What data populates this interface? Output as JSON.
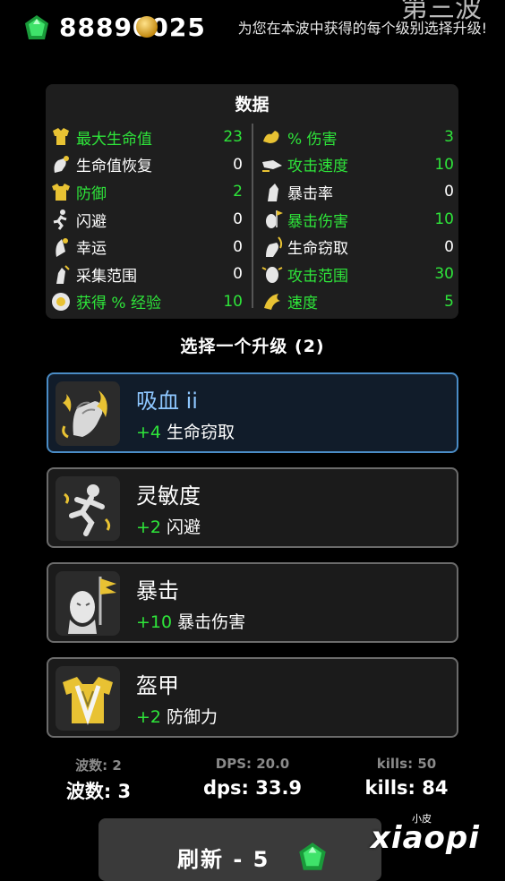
{
  "header": {
    "gem_count": "88890025",
    "wave_title": "第三波",
    "hint": "为您在本波中获得的每个级别选择升级!"
  },
  "stats": {
    "title": "数据",
    "left": [
      {
        "label": "最大生命值",
        "value": "23",
        "highlight": true,
        "icon": "heart-torso-icon"
      },
      {
        "label": "生命值恢复",
        "value": "0",
        "highlight": false,
        "icon": "regen-hand-icon"
      },
      {
        "label": "防御",
        "value": "2",
        "highlight": true,
        "icon": "armor-icon"
      },
      {
        "label": "闪避",
        "value": "0",
        "highlight": false,
        "icon": "dodge-runner-icon"
      },
      {
        "label": "幸运",
        "value": "0",
        "highlight": false,
        "icon": "luck-hand-icon"
      },
      {
        "label": "采集范围",
        "value": "0",
        "highlight": false,
        "icon": "pickup-range-icon"
      },
      {
        "label": "获得 % 经验",
        "value": "10",
        "highlight": true,
        "icon": "xp-head-icon"
      }
    ],
    "right": [
      {
        "label": "% 伤害",
        "value": "3",
        "highlight": true,
        "icon": "muscle-arm-icon"
      },
      {
        "label": "攻击速度",
        "value": "10",
        "highlight": true,
        "icon": "attack-speed-icon"
      },
      {
        "label": "暴击率",
        "value": "0",
        "highlight": false,
        "icon": "crit-chance-icon"
      },
      {
        "label": "暴击伤害",
        "value": "10",
        "highlight": true,
        "icon": "crit-damage-icon"
      },
      {
        "label": "生命窃取",
        "value": "0",
        "highlight": false,
        "icon": "lifesteal-icon"
      },
      {
        "label": "攻击范围",
        "value": "30",
        "highlight": true,
        "icon": "attack-range-icon"
      },
      {
        "label": "速度",
        "value": "5",
        "highlight": true,
        "icon": "speed-wing-icon"
      }
    ]
  },
  "choose": {
    "title": "选择一个升级 (2)"
  },
  "upgrades": [
    {
      "name": "吸血 ii",
      "amount": "+4",
      "stat": "生命窃取",
      "icon": "lifesteal-fist-icon",
      "selected": true
    },
    {
      "name": "灵敏度",
      "amount": "+2",
      "stat": "闪避",
      "icon": "agility-runner-icon",
      "selected": false
    },
    {
      "name": "暴击",
      "amount": "+10",
      "stat": "暴击伤害",
      "icon": "crit-flag-head-icon",
      "selected": false
    },
    {
      "name": "盔甲",
      "amount": "+2",
      "stat": "防御力",
      "icon": "armor-vest-icon",
      "selected": false
    }
  ],
  "footer": {
    "prev_wave": "波数: 2",
    "prev_dps": "DPS: 20.0",
    "prev_kills": "kills: 50",
    "cur_wave": "波数: 3",
    "cur_dps": "dps: 33.9",
    "cur_kills": "kills: 84"
  },
  "refresh": {
    "label": "刷新 - 5"
  },
  "watermark": {
    "small": "小皮",
    "large": "xiaopi"
  },
  "colors": {
    "highlight": "#2ee53a",
    "selected_border": "#4a8cc6",
    "selected_name": "#8ec7ff",
    "gem": "#22c24a",
    "icon_gold": "#e8c233"
  }
}
